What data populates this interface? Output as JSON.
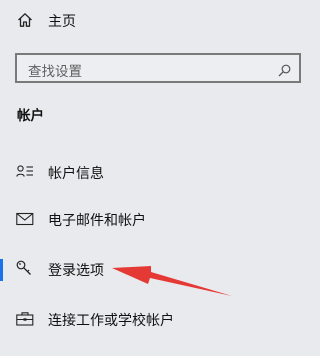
{
  "home": {
    "label": "主页",
    "icon": "home-icon"
  },
  "search": {
    "placeholder": "查找设置",
    "icon": "search-icon"
  },
  "section": {
    "title": "帐户"
  },
  "nav": {
    "items": [
      {
        "label": "帐户信息",
        "icon": "account-info-icon",
        "selected": false
      },
      {
        "label": "电子邮件和帐户",
        "icon": "mail-icon",
        "selected": false
      },
      {
        "label": "登录选项",
        "icon": "key-icon",
        "selected": true
      },
      {
        "label": "连接工作或学校帐户",
        "icon": "briefcase-icon",
        "selected": false
      }
    ]
  },
  "colors": {
    "background": "#e8eaed",
    "accent": "#1a73e8",
    "annotation_arrow": "#e53935"
  }
}
